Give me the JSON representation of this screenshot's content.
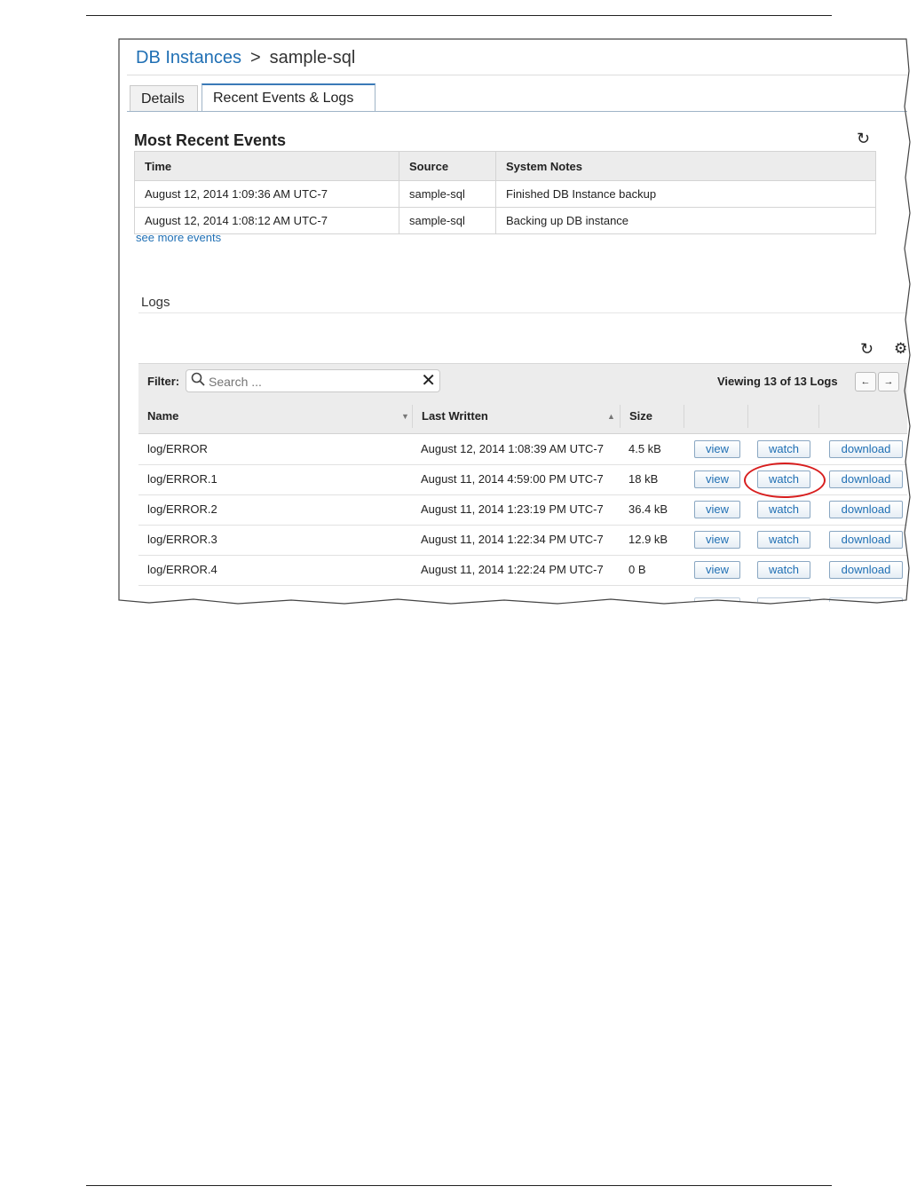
{
  "breadcrumb": {
    "parent": "DB Instances",
    "separator": ">",
    "current": "sample-sql"
  },
  "tabs": [
    {
      "label": "Details"
    },
    {
      "label": "Recent Events & Logs"
    }
  ],
  "events": {
    "title": "Most Recent Events",
    "headers": {
      "time": "Time",
      "source": "Source",
      "notes": "System Notes"
    },
    "rows": [
      {
        "time": "August 12, 2014 1:09:36 AM UTC-7",
        "source": "sample-sql",
        "notes": "Finished DB Instance backup"
      },
      {
        "time": "August 12, 2014 1:08:12 AM UTC-7",
        "source": "sample-sql",
        "notes": "Backing up DB instance"
      }
    ],
    "more_link": "see more events"
  },
  "logs": {
    "title": "Logs",
    "filter_label": "Filter:",
    "search_placeholder": "Search ...",
    "viewing": "Viewing 13 of 13 Logs",
    "prev": "←",
    "next": "→",
    "headers": {
      "name": "Name",
      "last_written": "Last Written",
      "size": "Size"
    },
    "rows": [
      {
        "name": "log/ERROR",
        "written": "August 12, 2014 1:08:39 AM UTC-7",
        "size": "4.5 kB"
      },
      {
        "name": "log/ERROR.1",
        "written": "August 11, 2014 4:59:00 PM UTC-7",
        "size": "18 kB"
      },
      {
        "name": "log/ERROR.2",
        "written": "August 11, 2014 1:23:19 PM UTC-7",
        "size": "36.4 kB"
      },
      {
        "name": "log/ERROR.3",
        "written": "August 11, 2014 1:22:34 PM UTC-7",
        "size": "12.9 kB"
      },
      {
        "name": "log/ERROR.4",
        "written": "August 11, 2014 1:22:24 PM UTC-7",
        "size": "0 B"
      }
    ],
    "buttons": {
      "view": "view",
      "watch": "watch",
      "download": "download"
    }
  },
  "icons": {
    "refresh": "↻",
    "gear": "⚙",
    "search": "🔍",
    "clear": "✕"
  },
  "colors": {
    "link": "#1f6fb4",
    "highlight_circle": "#d81e1e"
  }
}
